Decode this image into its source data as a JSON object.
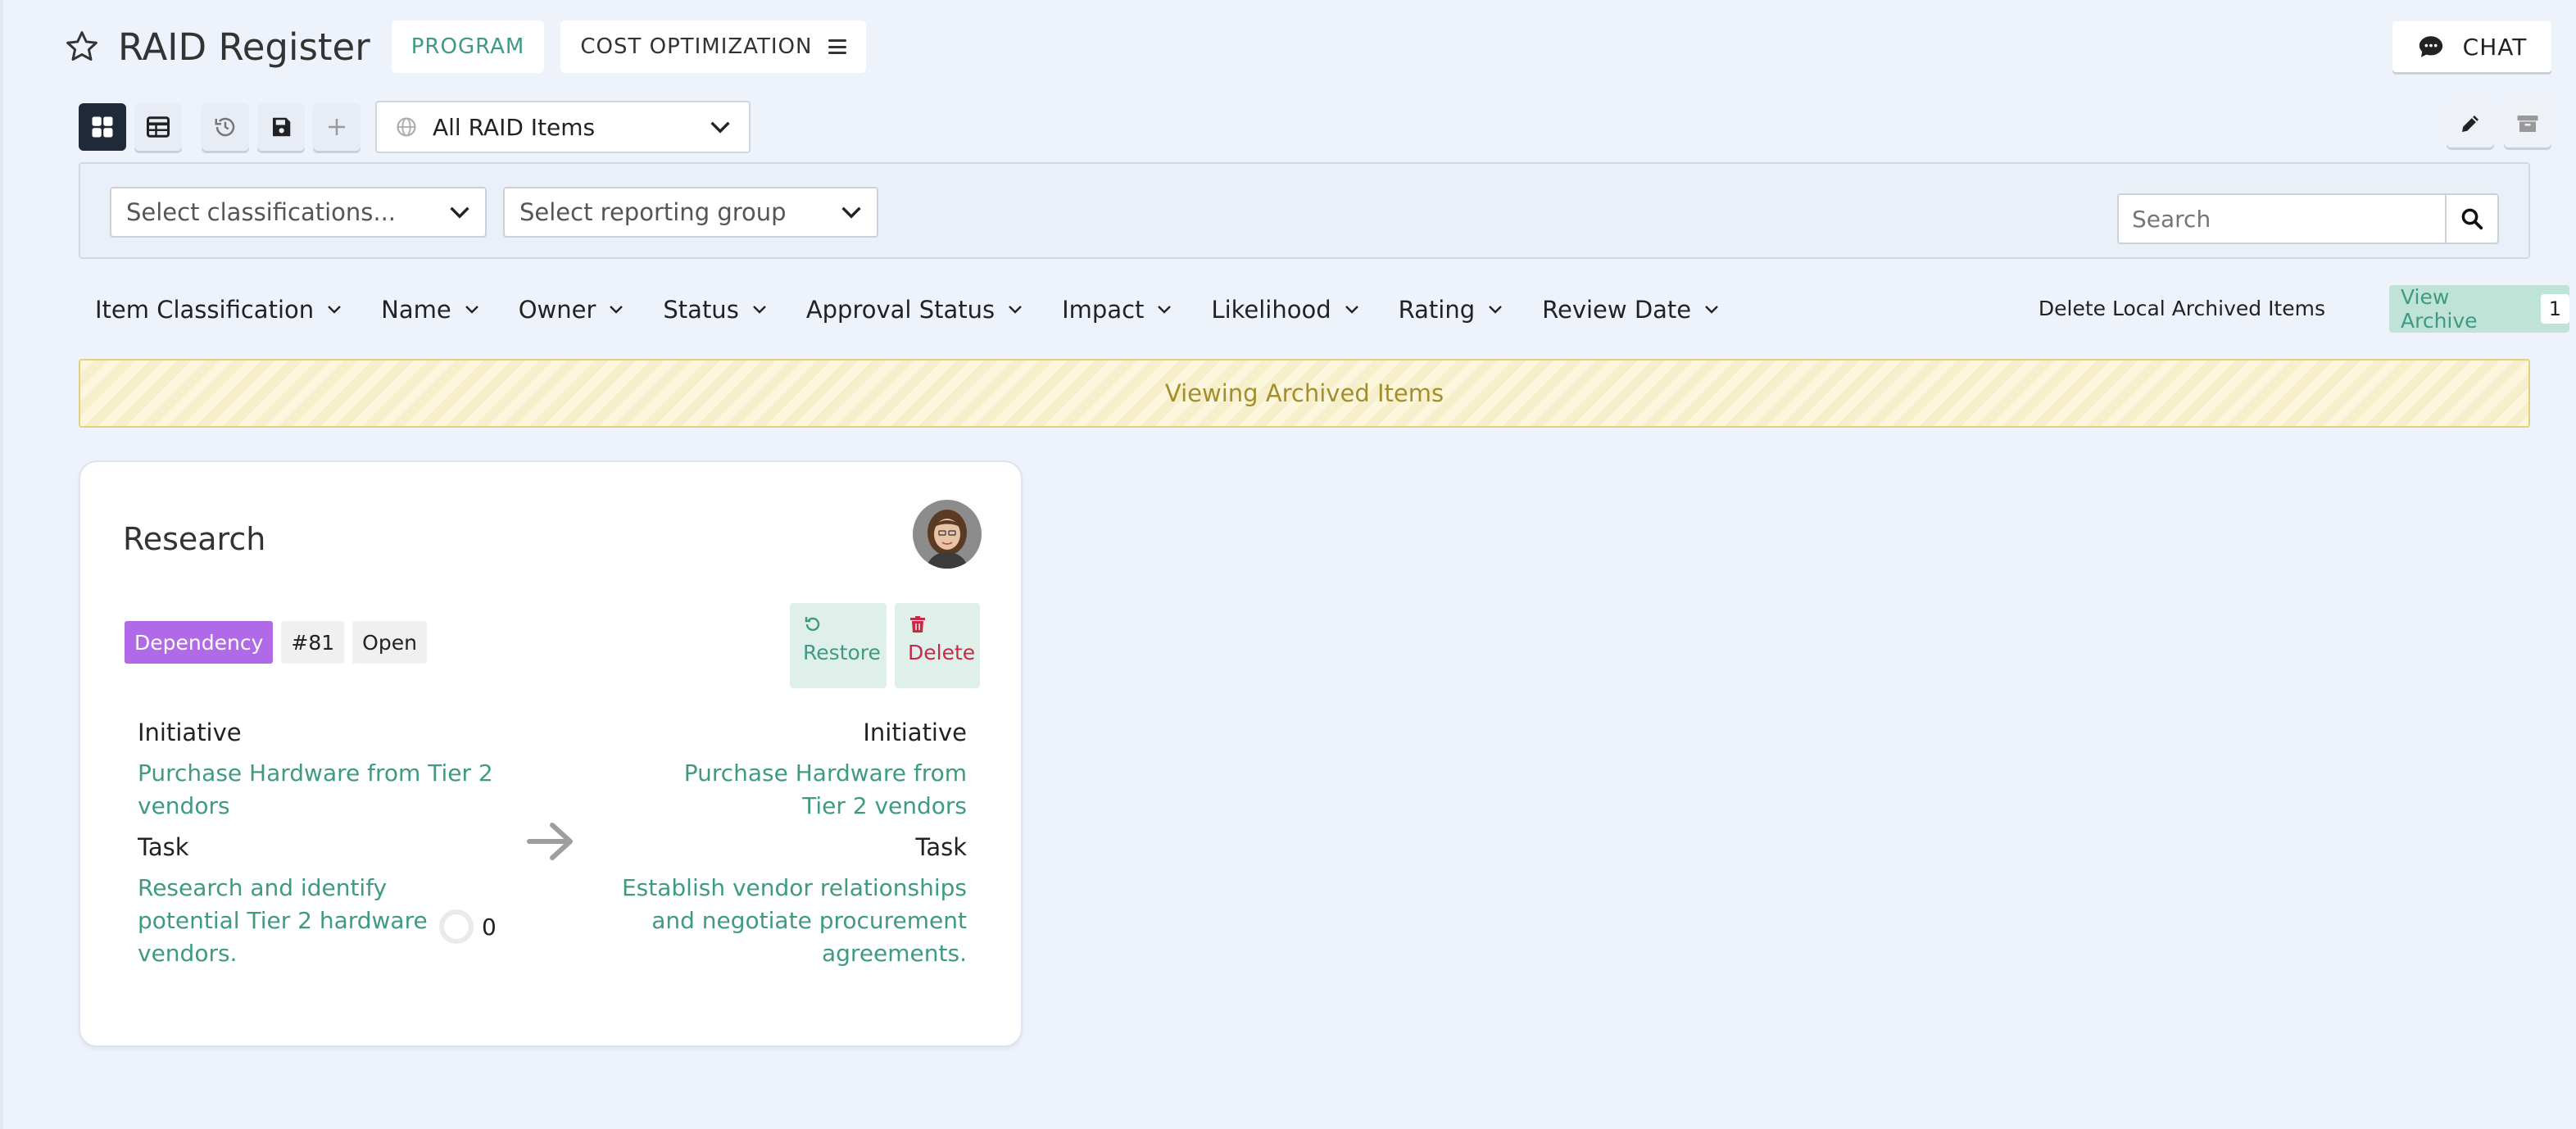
{
  "header": {
    "title": "RAID Register",
    "program_label": "PROGRAM",
    "project_label": "COST OPTIMIZATION",
    "chat_label": "CHAT"
  },
  "toolbar": {
    "view_select": "All RAID Items"
  },
  "filters": {
    "classifications_placeholder": "Select classifications...",
    "reporting_group_placeholder": "Select reporting group",
    "search_placeholder": "Search"
  },
  "sort_columns": [
    "Item Classification",
    "Name",
    "Owner",
    "Status",
    "Approval Status",
    "Impact",
    "Likelihood",
    "Rating",
    "Review Date"
  ],
  "archive": {
    "delete_local_label": "Delete Local Archived Items",
    "view_archive_label": "View Archive",
    "archive_count": "1",
    "banner": "Viewing Archived Items"
  },
  "card": {
    "title": "Research",
    "tags": {
      "type": "Dependency",
      "id": "#81",
      "status": "Open"
    },
    "restore_label": "Restore",
    "delete_label": "Delete",
    "left": {
      "initiative_label": "Initiative",
      "initiative_value": "Purchase Hardware from Tier 2 vendors",
      "task_label": "Task",
      "task_value": "Research and identify potential Tier 2 hardware vendors."
    },
    "right": {
      "initiative_label": "Initiative",
      "initiative_value": "Purchase Hardware from Tier 2 vendors",
      "task_label": "Task",
      "task_value": "Establish vendor relationships and negotiate procurement agreements."
    },
    "progress_count": "0"
  },
  "colors": {
    "accent": "#3f9a83",
    "dependency": "#b06ae8",
    "danger": "#c62a47",
    "banner_text": "#a38e2c"
  }
}
